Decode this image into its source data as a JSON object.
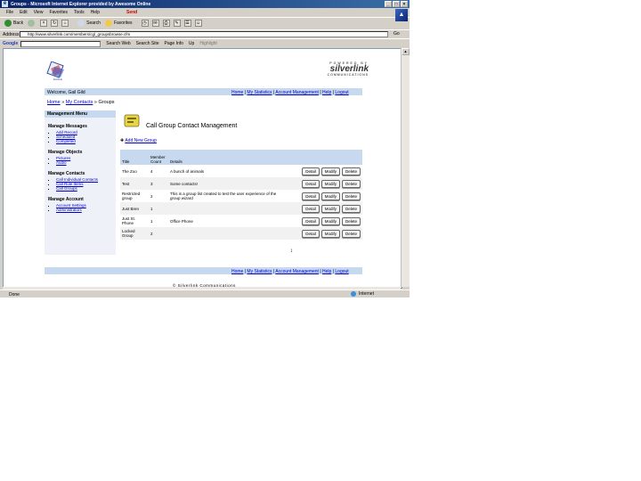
{
  "window": {
    "title": "Groups - Microsoft Internet Explorer provided by Awesome Online",
    "controls": [
      "_",
      "□",
      "×"
    ]
  },
  "menu": {
    "items": [
      "File",
      "Edit",
      "View",
      "Favorites",
      "Tools",
      "Help"
    ],
    "send_label": "Send"
  },
  "toolbar": {
    "back_label": "Back",
    "search_label": "Search",
    "favorites_label": "Favorites"
  },
  "address": {
    "label": "Address",
    "value": "http://www.silverlink.com/members/cgl_groupsbrowse.cfm",
    "go_label": "Go"
  },
  "google": {
    "logo": "Google",
    "search_web": "Search Web",
    "search_site": "Search Site",
    "page_info": "Page Info",
    "up": "Up",
    "highlight": "Highlight"
  },
  "brand": {
    "powered_by": "POWERED BY",
    "name": "silverlink",
    "tagline": "COMMUNICATIONS"
  },
  "header": {
    "welcome": "Welcome, Gail Gild",
    "nav": [
      "Home",
      "My Statistics",
      "Account Management",
      "Help",
      "Logout"
    ]
  },
  "breadcrumb": [
    "Home",
    "My Contacts",
    "Groups"
  ],
  "sidebar": {
    "title": "Management Menu",
    "sections": [
      {
        "title": "Manage Messages",
        "items": [
          "Add Record",
          "Scheduled",
          "Completed"
        ]
      },
      {
        "title": "Manage Objects",
        "items": [
          "Pictures",
          "Audio"
        ]
      },
      {
        "title": "Manage Contacts",
        "items": [
          "Call Individual Contacts",
          "Call Rule Items",
          "Call Groups"
        ]
      },
      {
        "title": "Manage Account",
        "items": [
          "Account Settings",
          "Administrators"
        ]
      }
    ]
  },
  "main": {
    "title": "Call Group Contact Management",
    "add_link": "Add New Group",
    "columns": [
      "Title",
      "Member Count",
      "Details",
      ""
    ],
    "rows": [
      {
        "title": "The Zoo",
        "count": "4",
        "details": "A bunch of animals"
      },
      {
        "title": "Test",
        "count": "3",
        "details": "Some contacts!"
      },
      {
        "title": "Restricted group",
        "count": "2",
        "details": "This is a group list created to test the user experience of the group wizard"
      },
      {
        "title": "Just Bren",
        "count": "1",
        "details": ""
      },
      {
        "title": "Just St. Phone",
        "count": "1",
        "details": "Office Phone"
      },
      {
        "title": "Locked Group",
        "count": "2",
        "details": ""
      }
    ],
    "actions": [
      "Detail",
      "Modify",
      "Delete"
    ]
  },
  "footer": {
    "nav": [
      "Home",
      "My Statistics",
      "Account Management",
      "Help",
      "Logout"
    ],
    "copyright": "© Silverlink Communications"
  },
  "status": {
    "left": "Done",
    "zone": "Internet"
  }
}
